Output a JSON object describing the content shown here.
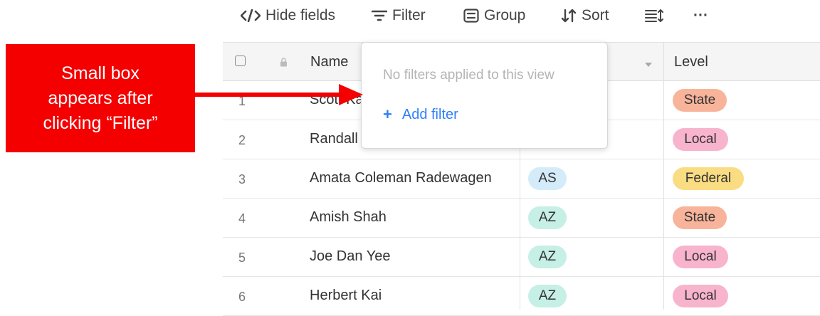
{
  "toolbar": {
    "hide_fields": "Hide fields",
    "filter": "Filter",
    "group": "Group",
    "sort": "Sort",
    "more": "···"
  },
  "table": {
    "columns": {
      "name": "Name",
      "level": "Level"
    },
    "rows": [
      {
        "num": "1",
        "name": "Scott Ka",
        "state": "",
        "level": "State"
      },
      {
        "num": "2",
        "name": "Randall",
        "state": "",
        "level": "Local"
      },
      {
        "num": "3",
        "name": "Amata Coleman Radewagen",
        "state": "AS",
        "level": "Federal"
      },
      {
        "num": "4",
        "name": "Amish Shah",
        "state": "AZ",
        "level": "State"
      },
      {
        "num": "5",
        "name": "Joe Dan Yee",
        "state": "AZ",
        "level": "Local"
      },
      {
        "num": "6",
        "name": "Herbert Kai",
        "state": "AZ",
        "level": "Local"
      }
    ]
  },
  "filter_popup": {
    "empty_text": "No filters applied to this view",
    "add_label": "Add filter"
  },
  "annotation": {
    "line1": "Small box",
    "line2": "appears after",
    "line3": "clicking “Filter”"
  },
  "colors": {
    "level_state": "#f8b49a",
    "level_local": "#f8b4cc",
    "level_federal": "#fadc82",
    "state_as": "#d4ebfa",
    "state_az": "#c6efe6",
    "accent": "#2d7ff9",
    "annotation": "#f40000"
  }
}
